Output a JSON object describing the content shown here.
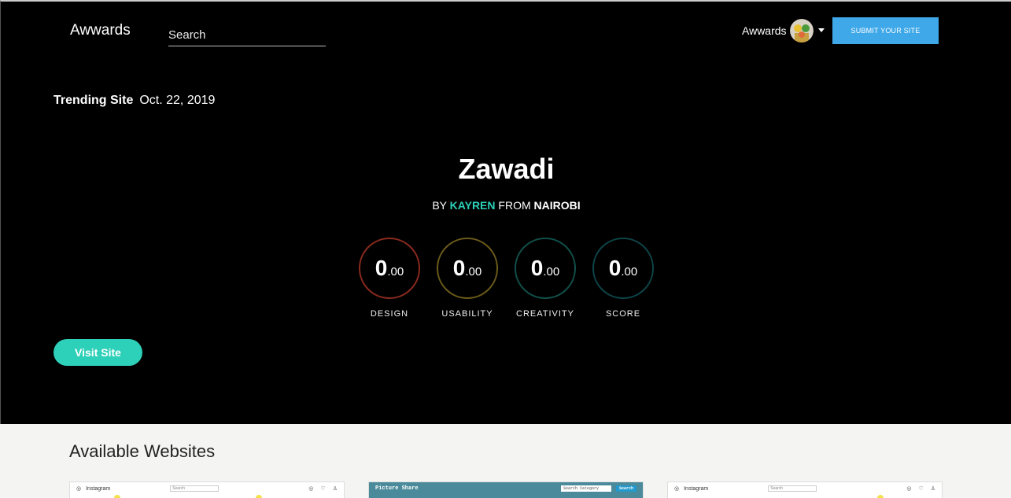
{
  "header": {
    "brand": "Awwards",
    "search_placeholder": "Search",
    "user_name": "Awwards",
    "submit_label": "SUBMIT YOUR SITE"
  },
  "hero": {
    "trending_label": "Trending Site",
    "trending_date": "Oct. 22, 2019",
    "site_title": "Zawadi",
    "by_prefix": "BY",
    "author": "KAYREN",
    "from_word": "FROM",
    "city": "NAIROBI",
    "scores": [
      {
        "label": "DESIGN",
        "whole": "0",
        "decimal": ".00",
        "ring_color": "#8a2a1e"
      },
      {
        "label": "USABILITY",
        "whole": "0",
        "decimal": ".00",
        "ring_color": "#6b5a1a"
      },
      {
        "label": "CREATIVITY",
        "whole": "0",
        "decimal": ".00",
        "ring_color": "#11504a"
      },
      {
        "label": "SCORE",
        "whole": "0",
        "decimal": ".00",
        "ring_color": "#0d4448"
      }
    ],
    "visit_label": "Visit Site"
  },
  "section": {
    "title": "Available Websites",
    "thumbs": [
      {
        "brand": "Instagram",
        "search": "Search"
      },
      {
        "brand": "Picture Share",
        "search": "Search Category",
        "button": "Search"
      },
      {
        "brand": "Instagram",
        "search": "Search"
      }
    ]
  },
  "colors": {
    "accent": "#2dd0b8",
    "submit": "#3ea8e8"
  }
}
